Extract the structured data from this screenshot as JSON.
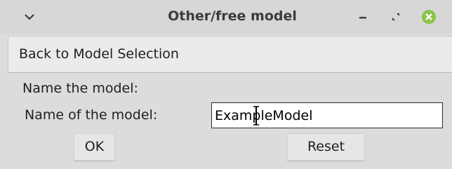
{
  "window": {
    "title": "Other/free model",
    "icons": {
      "menu": "chevron-down-icon",
      "minimize": "minimize-icon",
      "maximize": "maximize-icon",
      "close": "close-icon"
    },
    "colors": {
      "close_button": "#8bc34a",
      "background": "#dcdcdc"
    }
  },
  "main": {
    "back_button_label": "Back to Model Selection",
    "section_label": "Name the model:",
    "name_field": {
      "label": "Name of the model:",
      "value": "ExampleModel"
    },
    "ok_label": "OK",
    "reset_label": "Reset"
  }
}
